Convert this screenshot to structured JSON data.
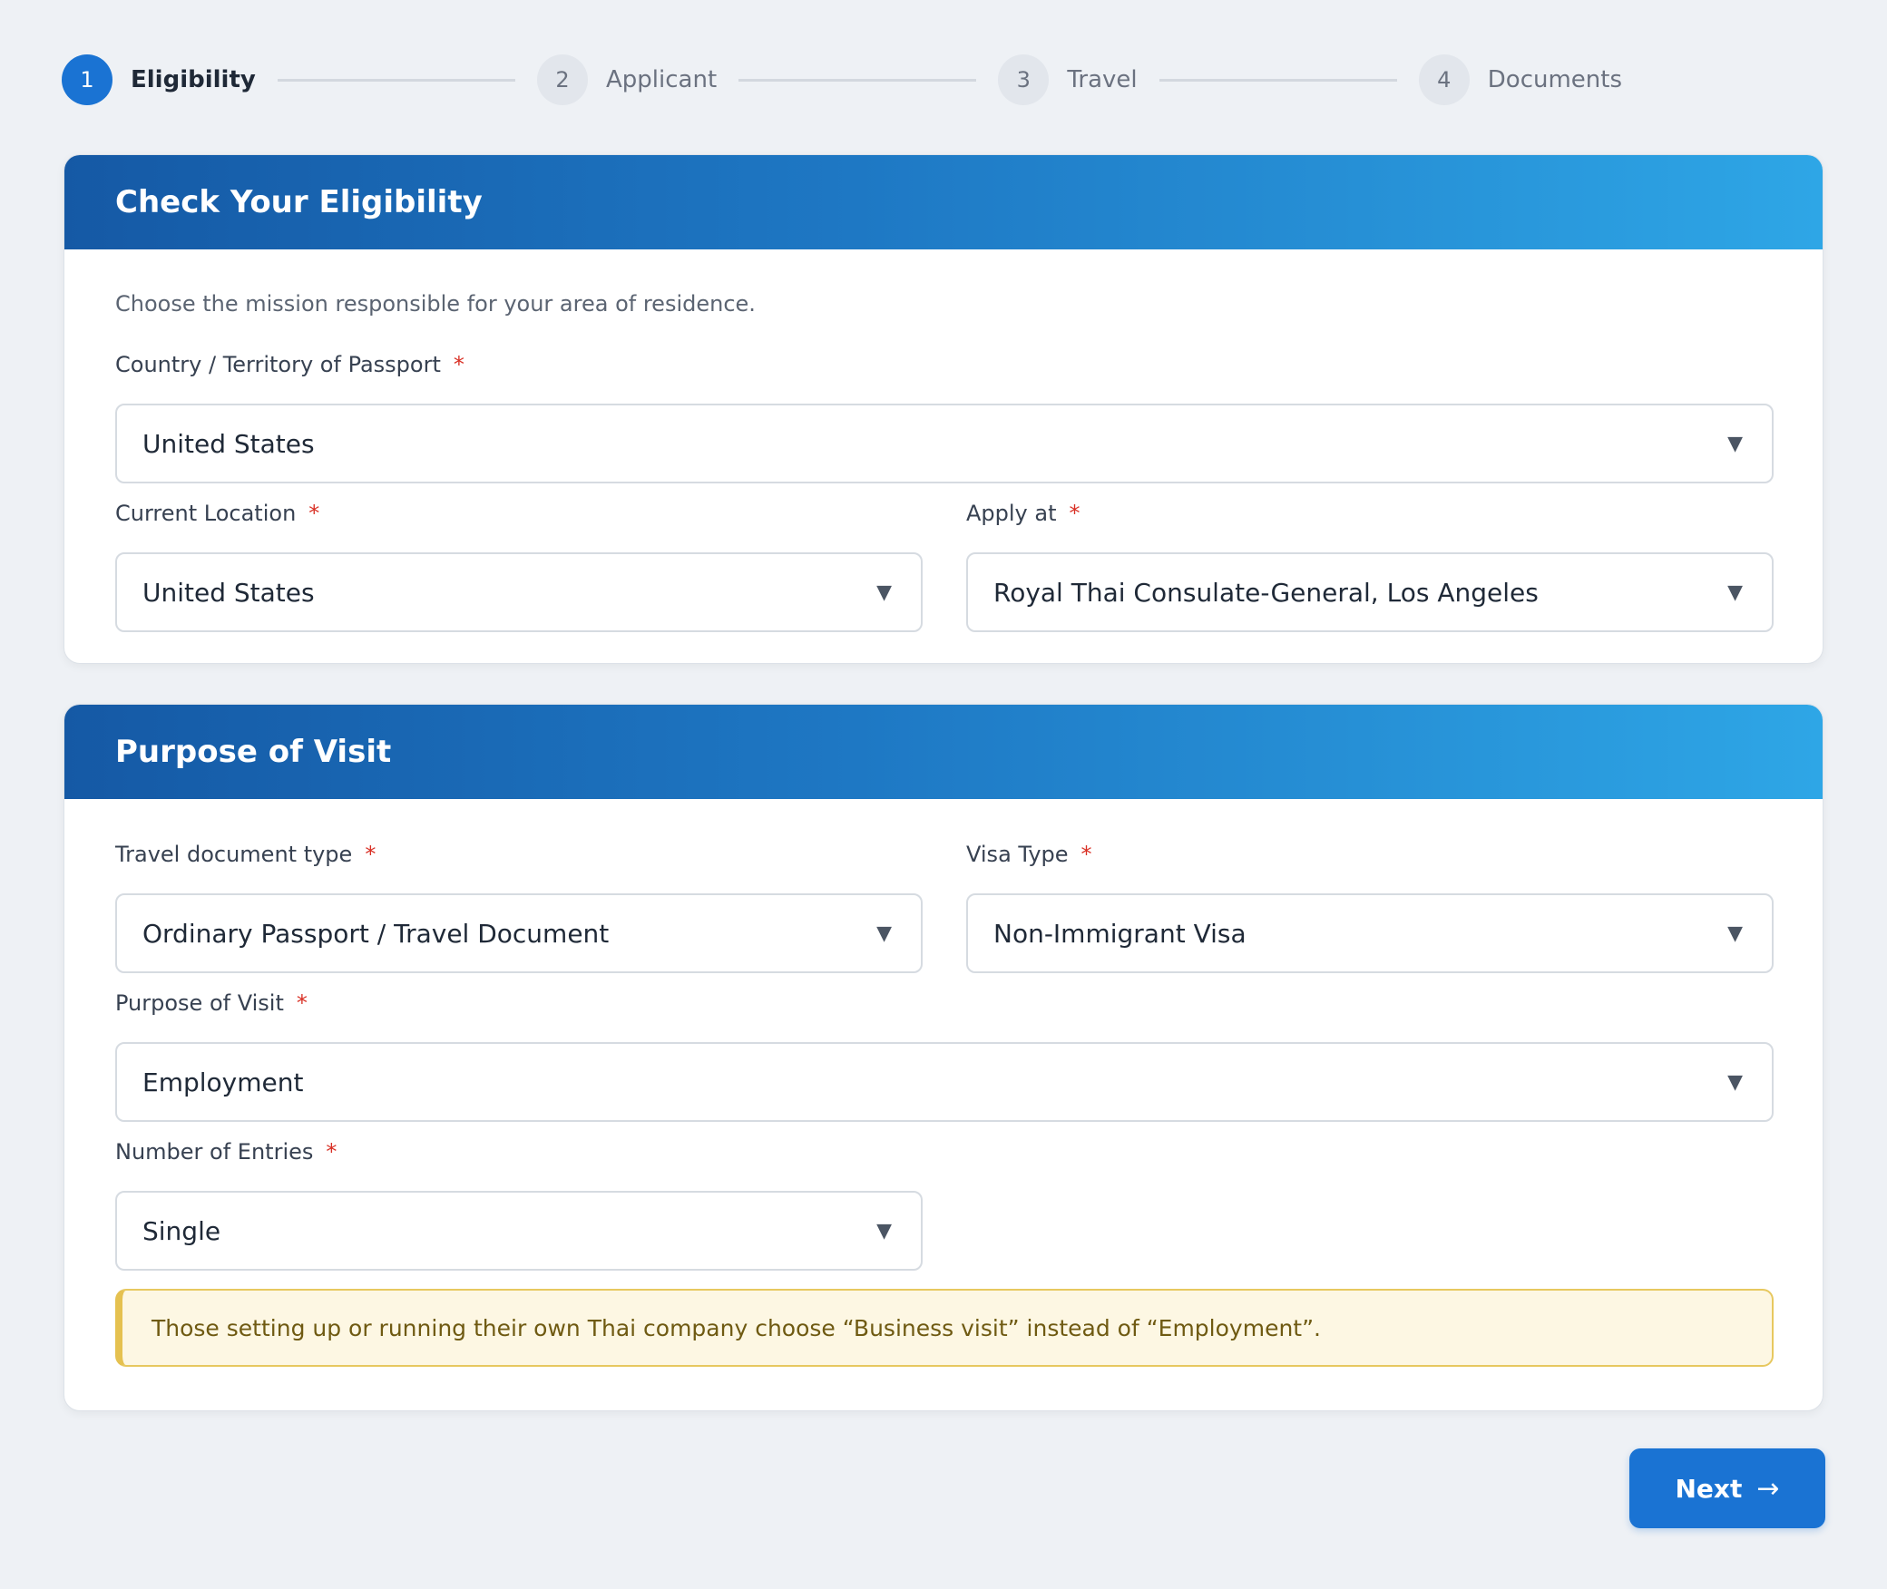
{
  "stepper": {
    "steps": [
      {
        "number": "1",
        "label": "Eligibility",
        "active": true
      },
      {
        "number": "2",
        "label": "Applicant",
        "active": false
      },
      {
        "number": "3",
        "label": "Travel",
        "active": false
      },
      {
        "number": "4",
        "label": "Documents",
        "active": false
      }
    ]
  },
  "eligibility": {
    "title": "Check Your Eligibility",
    "intro": "Choose the mission responsible for your area of residence.",
    "passport_country": {
      "label": "Country / Territory of Passport",
      "required": "*",
      "value": "United States"
    },
    "current_location": {
      "label": "Current Location",
      "required": "*",
      "value": "United States"
    },
    "apply_at": {
      "label": "Apply at",
      "required": "*",
      "value": "Royal Thai Consulate-General, Los Angeles"
    }
  },
  "purpose": {
    "title": "Purpose of Visit",
    "document_type": {
      "label": "Travel document type",
      "required": "*",
      "value": "Ordinary Passport / Travel Document"
    },
    "visa_type": {
      "label": "Visa Type",
      "required": "*",
      "value": "Non-Immigrant Visa"
    },
    "purpose_of_visit": {
      "label": "Purpose of Visit",
      "required": "*",
      "value": "Employment"
    },
    "entries": {
      "label": "Number of Entries",
      "required": "*",
      "value": "Single"
    },
    "note": "Those setting up or running their own Thai company choose “Business visit” instead of “Employment”."
  },
  "actions": {
    "next_label": "Next",
    "next_arrow": "→"
  },
  "icons": {
    "caret": "▼"
  },
  "colors": {
    "primary": "#1a73d3",
    "required": "#d93025",
    "note_border": "#e5c150"
  }
}
